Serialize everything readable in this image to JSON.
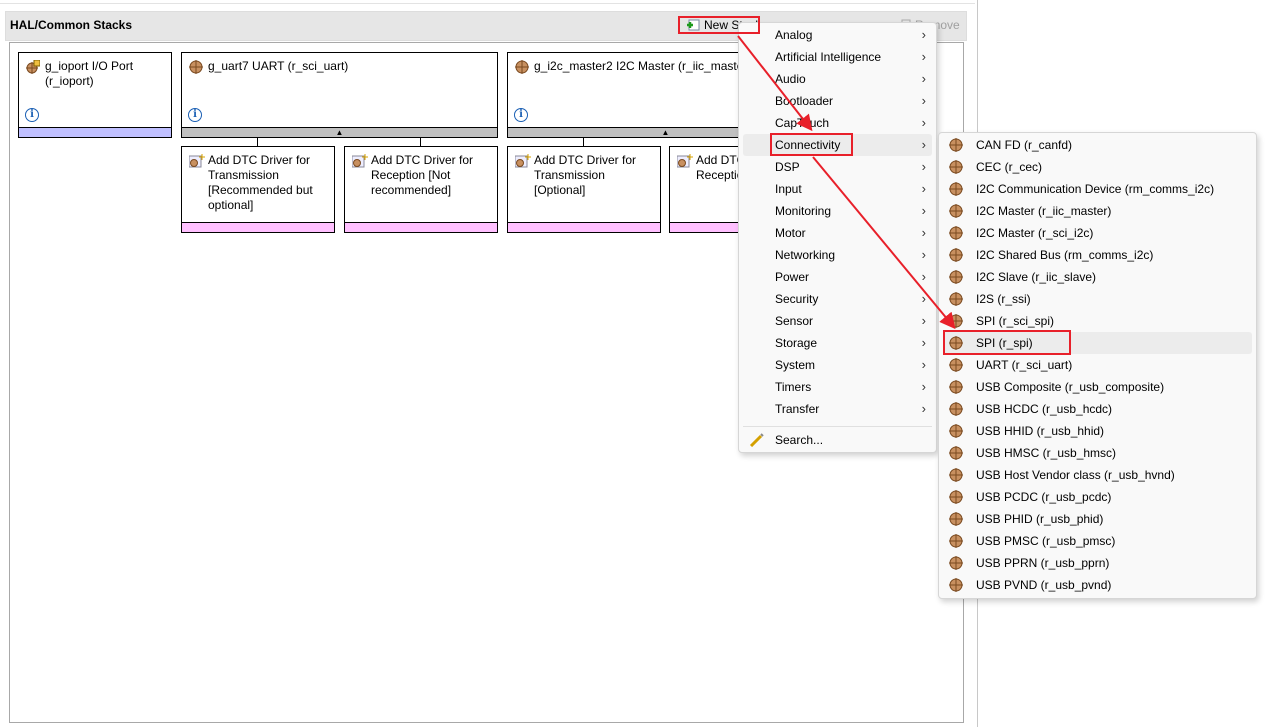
{
  "panel": {
    "title": "HAL/Common Stacks",
    "new_stack": "New Stack",
    "remove": "Remove"
  },
  "stacks": [
    {
      "title": "g_ioport I/O Port (r_ioport)",
      "band": "lavender"
    },
    {
      "title": "g_uart7 UART (r_sci_uart)",
      "band": "gray"
    },
    {
      "title": "g_i2c_master2 I2C Master (r_iic_master)",
      "band": "gray"
    }
  ],
  "children": [
    "Add DTC Driver for Transmission [Recommended but optional]",
    "Add DTC Driver for Reception [Not recommended]",
    "Add DTC Driver for Transmission [Optional]",
    "Add DTC Driver for Reception"
  ],
  "menu": {
    "items": [
      "Analog",
      "Artificial Intelligence",
      "Audio",
      "Bootloader",
      "CapTouch",
      "Connectivity",
      "DSP",
      "Input",
      "Monitoring",
      "Motor",
      "Networking",
      "Power",
      "Security",
      "Sensor",
      "Storage",
      "System",
      "Timers",
      "Transfer"
    ],
    "highlighted": "Connectivity",
    "search": "Search..."
  },
  "submenu": {
    "items": [
      "CAN FD (r_canfd)",
      "CEC (r_cec)",
      "I2C Communication Device (rm_comms_i2c)",
      "I2C Master (r_iic_master)",
      "I2C Master (r_sci_i2c)",
      "I2C Shared Bus (rm_comms_i2c)",
      "I2C Slave (r_iic_slave)",
      "I2S (r_ssi)",
      "SPI (r_sci_spi)",
      "SPI (r_spi)",
      "UART (r_sci_uart)",
      "USB Composite (r_usb_composite)",
      "USB HCDC (r_usb_hcdc)",
      "USB HHID (r_usb_hhid)",
      "USB HMSC (r_usb_hmsc)",
      "USB Host Vendor class (r_usb_hvnd)",
      "USB PCDC (r_usb_pcdc)",
      "USB PHID (r_usb_phid)",
      "USB PMSC (r_usb_pmsc)",
      "USB PPRN (r_usb_pprn)",
      "USB PVND (r_usb_pvnd)"
    ],
    "highlighted": "SPI (r_spi)"
  },
  "colors": {
    "annotation": "#e8202a",
    "band_lavender": "#c0c0ff",
    "band_pink": "#ffc0ff"
  }
}
